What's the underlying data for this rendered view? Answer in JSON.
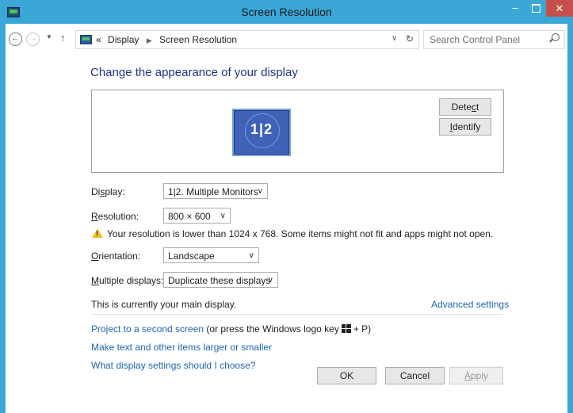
{
  "window": {
    "title": "Screen Resolution",
    "minimize": "–",
    "close": "✕"
  },
  "address": {
    "back": "←",
    "forward": "→",
    "history": "▼",
    "up": "↑",
    "overflow": "«",
    "crumb1": "Display",
    "crumb_sep": "▶",
    "crumb2": "Screen Resolution",
    "dropdown": "∨",
    "refresh": "↻",
    "search_placeholder": "Search Control Panel"
  },
  "main": {
    "heading": "Change the appearance of your display",
    "monitor_number": "1|2",
    "detect_pre": "Dete",
    "detect_u": "c",
    "detect_post": "t",
    "identify_u": "I",
    "identify_post": "dentify",
    "display_label_pre": "Di",
    "display_label_u": "s",
    "display_label_post": "play:",
    "display_value": "1|2. Multiple Monitors",
    "resolution_label_u": "R",
    "resolution_label_post": "esolution:",
    "resolution_value": "800 × 600",
    "warning": "Your resolution is lower than 1024 x 768. Some items might not fit and apps might not open.",
    "orientation_label_u": "O",
    "orientation_label_post": "rientation:",
    "orientation_value": "Landscape",
    "multiple_label_u": "M",
    "multiple_label_post": "ultiple displays:",
    "multiple_value": "Duplicate these displays",
    "main_display": "This is currently your main display.",
    "advanced": "Advanced settings",
    "project_link": "Project to a second screen",
    "project_tail_pre": "(or press the Windows logo key",
    "project_tail_post": "+ P)",
    "text_size_link": "Make text and other items larger or smaller",
    "help_link": "What display settings should I choose?"
  },
  "buttons": {
    "ok": "OK",
    "cancel": "Cancel",
    "apply_u": "A",
    "apply_post": "pply"
  },
  "colors": {
    "frame": "#3aa7d6",
    "link": "#1e64b4",
    "heading": "#1e3287",
    "close": "#c7504b"
  }
}
